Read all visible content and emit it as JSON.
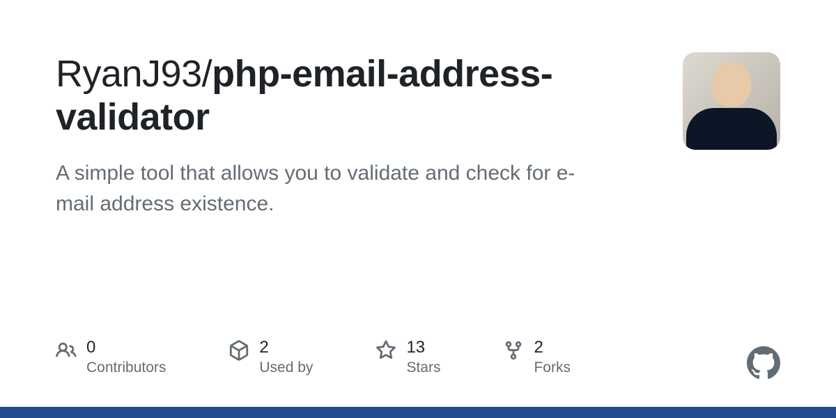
{
  "repo": {
    "owner": "RyanJ93",
    "name": "php-email-address-validator",
    "description": "A simple tool that allows you to validate and check for e-mail address existence."
  },
  "stats": [
    {
      "icon": "people",
      "value": "0",
      "label": "Contributors"
    },
    {
      "icon": "package",
      "value": "2",
      "label": "Used by"
    },
    {
      "icon": "star",
      "value": "13",
      "label": "Stars"
    },
    {
      "icon": "fork",
      "value": "2",
      "label": "Forks"
    }
  ]
}
